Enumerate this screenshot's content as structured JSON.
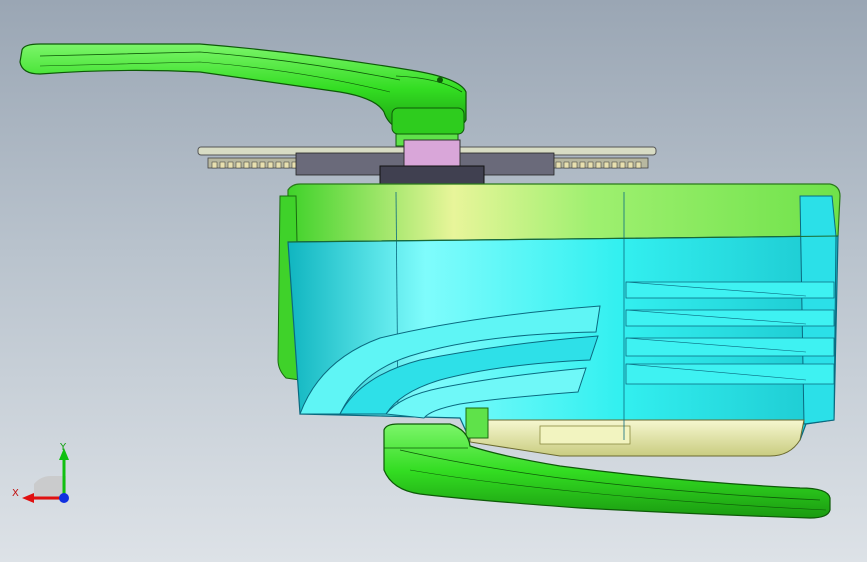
{
  "viewport": {
    "background_top": "#9aa6b4",
    "background_bottom": "#dde2e7"
  },
  "model": {
    "colors": {
      "crank_green": "#33dd22",
      "crank_dark": "#1a9a10",
      "motor_cyan": "#33f0f0",
      "motor_cyan_dark": "#10b5c0",
      "housing_green": "#7ff05a",
      "housing_lime": "#c8f07a",
      "cover_yellow": "#eef0b0",
      "chainring": "#c9c9b0",
      "axle_pink": "#d9a6d9"
    }
  },
  "triad": {
    "x_label": "X",
    "y_label": "Y",
    "x_color": "#e01010",
    "y_color": "#10c010",
    "z_color": "#1030e0"
  }
}
